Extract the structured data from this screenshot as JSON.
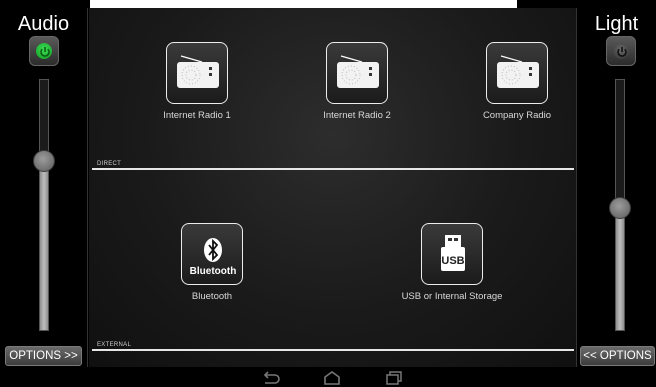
{
  "audio": {
    "title": "Audio",
    "power_state": "on",
    "volume_level": 0.68,
    "options_label": "OPTIONS >>"
  },
  "light": {
    "title": "Light",
    "power_state": "off",
    "level": 0.49,
    "options_label": "<< OPTIONS"
  },
  "sections": {
    "direct_label": "DIRECT",
    "external_label": "EXTERNAL"
  },
  "sources": {
    "internet_radio_1": "Internet Radio 1",
    "internet_radio_2": "Internet Radio 2",
    "company_radio": "Company Radio",
    "bluetooth": "Bluetooth",
    "bluetooth_logo_text": "Bluetooth",
    "usb": "USB or Internal Storage",
    "usb_logo_text": "USB"
  },
  "nav": {
    "back_icon": "back-icon",
    "home_icon": "home-icon",
    "recents_icon": "recents-icon"
  },
  "colors": {
    "power_on": "#2ecc40",
    "panel_bg": "#000000"
  }
}
